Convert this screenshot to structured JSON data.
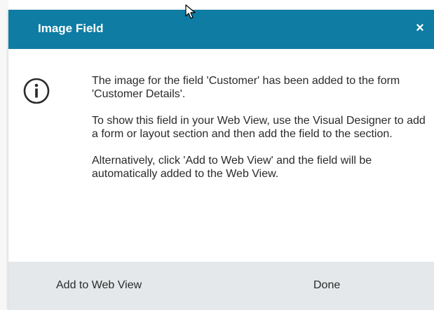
{
  "dialog": {
    "title": "Image Field",
    "close_label": "×",
    "icon": "info-icon",
    "message": {
      "p1": "The image for the field 'Customer' has been added to the form 'Customer Details'.",
      "p2": "To show this field in your Web View, use the Visual Designer to add a form or layout section and then add the field to the section.",
      "p3": "Alternatively, click 'Add to Web View' and the field will be automatically added to the Web View."
    },
    "buttons": {
      "add_to_web_view": "Add to Web View",
      "done": "Done"
    }
  },
  "colors": {
    "header": "#0e7ca3",
    "footer": "#e4e8ea",
    "text": "#2a2a2a"
  },
  "cursor_icon": "mouse-pointer-icon"
}
